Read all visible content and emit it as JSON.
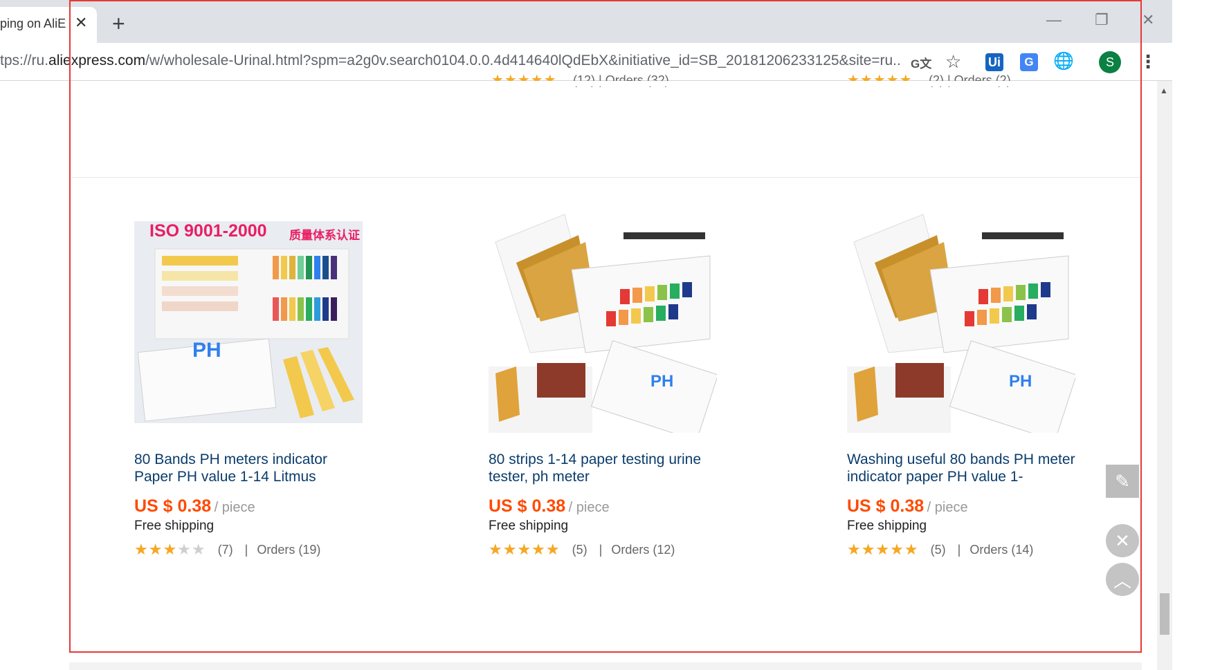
{
  "browser": {
    "tab_title": "ping on AliEx",
    "tab_close": "✕",
    "new_tab": "+",
    "minimize": "—",
    "restore": "❐",
    "close": "✕",
    "url_prefix": "tps://ru.",
    "url_host": "aliexpress.com",
    "url_rest": "/w/wholesale-Urinal.html?spm=a2g0v.search0104.0.0.4d414640lQdEbX&initiative_id=SB_20181206233125&site=ru...",
    "translate_icon": "G文",
    "star_icon": "☆",
    "ui_ext": "Ui",
    "gt_ext": "G",
    "globe_icon": "🌐",
    "profile_letter": "S",
    "menu_icon": "⋮"
  },
  "previous_row": [
    {
      "stars": "★★★★★",
      "meta": "(12)  |  Orders (32)"
    },
    {
      "stars": "★★★★★",
      "meta": "(2)  |  Orders (2)"
    }
  ],
  "products": [
    {
      "title": "80 Bands PH meters indicator Paper PH value 1-14 Litmus",
      "price": "US $ 0.38",
      "unit": "/ piece",
      "shipping": "Free shipping",
      "rating": 0.6,
      "reviews": "(7)",
      "orders": "Orders (19)",
      "image_banner": "ISO 9001-2000",
      "image_banner_cn": "质量体系认证",
      "image_label": "PH"
    },
    {
      "title": "80 strips 1-14 paper testing urine tester, ph meter",
      "price": "US $ 0.38",
      "unit": "/ piece",
      "shipping": "Free shipping",
      "rating": 1.0,
      "reviews": "(5)",
      "orders": "Orders (12)",
      "image_label": "PH"
    },
    {
      "title": "Washing useful 80 bands PH meter indicator paper PH value 1-",
      "price": "US $ 0.38",
      "unit": "/ piece",
      "shipping": "Free shipping",
      "rating": 1.0,
      "reviews": "(5)",
      "orders": "Orders (14)",
      "image_label": "PH"
    }
  ],
  "tools": {
    "edit_icon": "✎",
    "close_icon": "✕",
    "top_icon": "︿"
  },
  "colors": {
    "price": "#ff4a00",
    "title": "#0b3c6b",
    "star": "#f6a821",
    "frame": "#e53935",
    "profile": "#0b8043"
  }
}
